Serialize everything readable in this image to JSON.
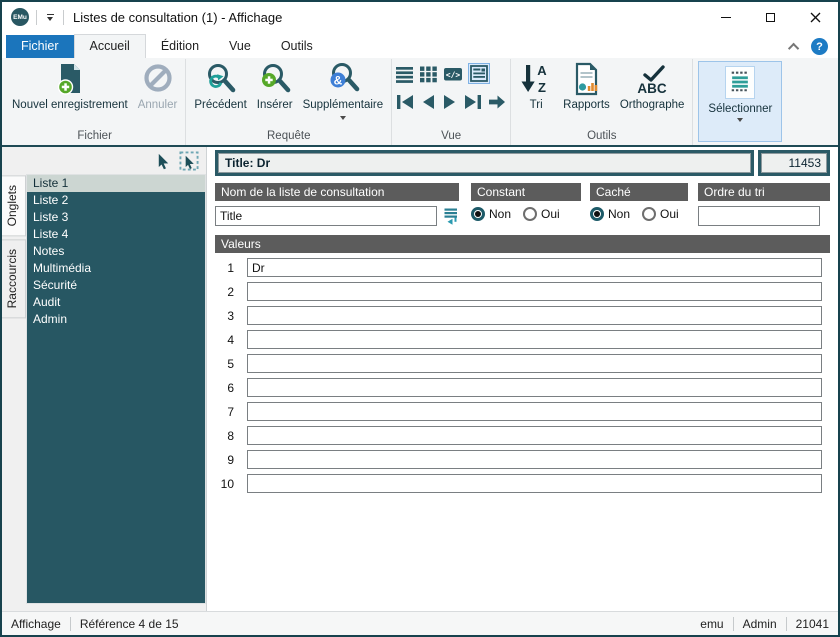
{
  "window": {
    "title": "Listes de consultation (1) - Affichage",
    "logo": "EMu"
  },
  "tabs": [
    {
      "label": "Fichier"
    },
    {
      "label": "Accueil"
    },
    {
      "label": "Édition"
    },
    {
      "label": "Vue"
    },
    {
      "label": "Outils"
    }
  ],
  "ribbon": {
    "file_group": {
      "label": "Fichier",
      "new_record": "Nouvel enregistrement",
      "cancel": "Annuler"
    },
    "query_group": {
      "label": "Requête",
      "previous": "Précédent",
      "insert": "Insérer",
      "additional": "Supplémentaire"
    },
    "view_group": {
      "label": "Vue"
    },
    "tools_group": {
      "label": "Outils",
      "sort": "Tri",
      "reports": "Rapports",
      "spelling": "Orthographe"
    },
    "select_button": "Sélectionner",
    "help": "?"
  },
  "sidebar": {
    "tabs": [
      {
        "label": "Onglets"
      },
      {
        "label": "Raccourcis"
      }
    ],
    "items": [
      {
        "label": "Liste 1"
      },
      {
        "label": "Liste 2"
      },
      {
        "label": "Liste 3"
      },
      {
        "label": "Liste 4"
      },
      {
        "label": "Notes"
      },
      {
        "label": "Multimédia"
      },
      {
        "label": "Sécurité"
      },
      {
        "label": "Audit"
      },
      {
        "label": "Admin"
      }
    ],
    "selected_item": "Liste 1"
  },
  "record": {
    "title": "Title: Dr",
    "id": "11453"
  },
  "form": {
    "name": {
      "header": "Nom de la liste de consultation",
      "value": "Title"
    },
    "constant": {
      "header": "Constant",
      "no": "Non",
      "yes": "Oui",
      "selected": "Non"
    },
    "hidden": {
      "header": "Caché",
      "no": "Non",
      "yes": "Oui",
      "selected": "Non"
    },
    "sort_order": {
      "header": "Ordre du tri",
      "value": ""
    },
    "values": {
      "header": "Valeurs",
      "rows": [
        {
          "num": "1",
          "value": "Dr"
        },
        {
          "num": "2",
          "value": ""
        },
        {
          "num": "3",
          "value": ""
        },
        {
          "num": "4",
          "value": ""
        },
        {
          "num": "5",
          "value": ""
        },
        {
          "num": "6",
          "value": ""
        },
        {
          "num": "7",
          "value": ""
        },
        {
          "num": "8",
          "value": ""
        },
        {
          "num": "9",
          "value": ""
        },
        {
          "num": "10",
          "value": ""
        }
      ]
    }
  },
  "statusbar": {
    "mode": "Affichage",
    "reference": "Référence 4 de 15",
    "user": "emu",
    "role": "Admin",
    "port": "21041"
  },
  "colors": {
    "teal": "#2A5A66",
    "teal_dark": "#1E4A55",
    "accent_blue": "#1B75BC",
    "header_gray": "#5C5C5C",
    "selected_item_bg": "#CCD6D2",
    "green": "#56A829",
    "badge_blue": "#3E7FD6"
  }
}
